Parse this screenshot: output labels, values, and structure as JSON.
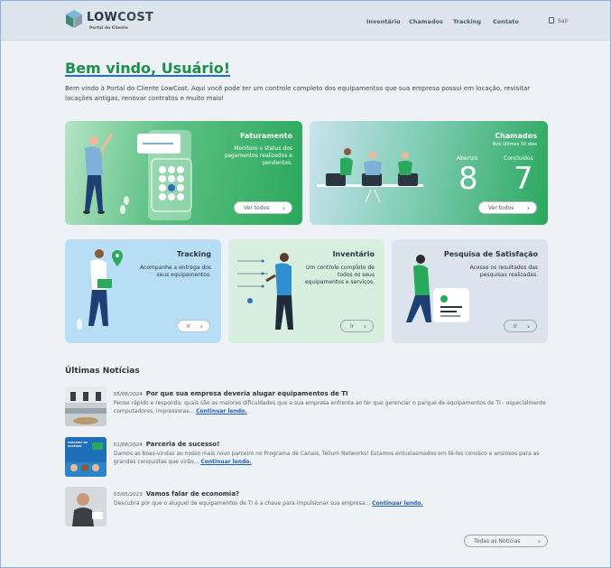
{
  "header": {
    "logo_text_low": "LOW",
    "logo_text_cost": "COST",
    "logo_sub": "Portal do Cliente",
    "nav": [
      "Inventário",
      "Chamados",
      "Tracking",
      "Contato"
    ],
    "logout": "Sair"
  },
  "welcome": {
    "title": "Bem vindo, Usuário!",
    "text": "Bem vindo à Portal do Cliente LowCost. Aqui você pode ter um controle completo dos equipamentos que sua empresa possui em locação, revisitar locações antigas, renovar contratos e muito mais!"
  },
  "cards": {
    "billing": {
      "title": "Faturamento",
      "desc": "Monitore o status dos pagamentos realizados e pendentes.",
      "button": "Ver todos"
    },
    "tickets": {
      "title": "Chamados",
      "subtitle": "Nos últimos 30 dias",
      "open_label": "Abertos",
      "open_value": "8",
      "closed_label": "Concluídos",
      "closed_value": "7",
      "button": "Ver todos"
    },
    "tracking": {
      "title": "Tracking",
      "desc": "Acompanhe a entrega dos seus equipamentos.",
      "button": "Ir"
    },
    "inventory": {
      "title": "Inventário",
      "desc": "Um controle completo de todos os seus equipamentos e serviços.",
      "button": "Ir"
    },
    "survey": {
      "title": "Pesquisa de Satisfação",
      "desc": "Acesse os resultados das pesquisas realizadas.",
      "button": "Ir"
    }
  },
  "news": {
    "heading": "Últimas Notícias",
    "link_label": "Continuar lendo.",
    "items": [
      {
        "date": "05/08/2024",
        "title": "Por que sua empresa deveria alugar equipamentos de TI",
        "body": "Pense rápido e responda: quais são as maiores dificuldades que a sua empresa enfrenta ao ter que gerenciar o parque de equipamentos de TI - especialmente computadores, impressoras..."
      },
      {
        "date": "01/08/2024",
        "title": "Parceria de sucesso!",
        "body": "Damos as boas-vindas ao nosso mais novo parceiro no Programa de Canais, Telium Networks! Estamos entusiasmados em tê-los conosco e ansiosos para as grandes conquistas que virão..."
      },
      {
        "date": "03/05/2023",
        "title": "Vamos falar de economia?",
        "body": "Descubra por que o aluguel de equipamentos de TI é a chave para impulsionar sua empresa..."
      }
    ],
    "thumb2_text": "PARCERIA DE SUCESSO",
    "all_button": "Todas as Notícias"
  }
}
